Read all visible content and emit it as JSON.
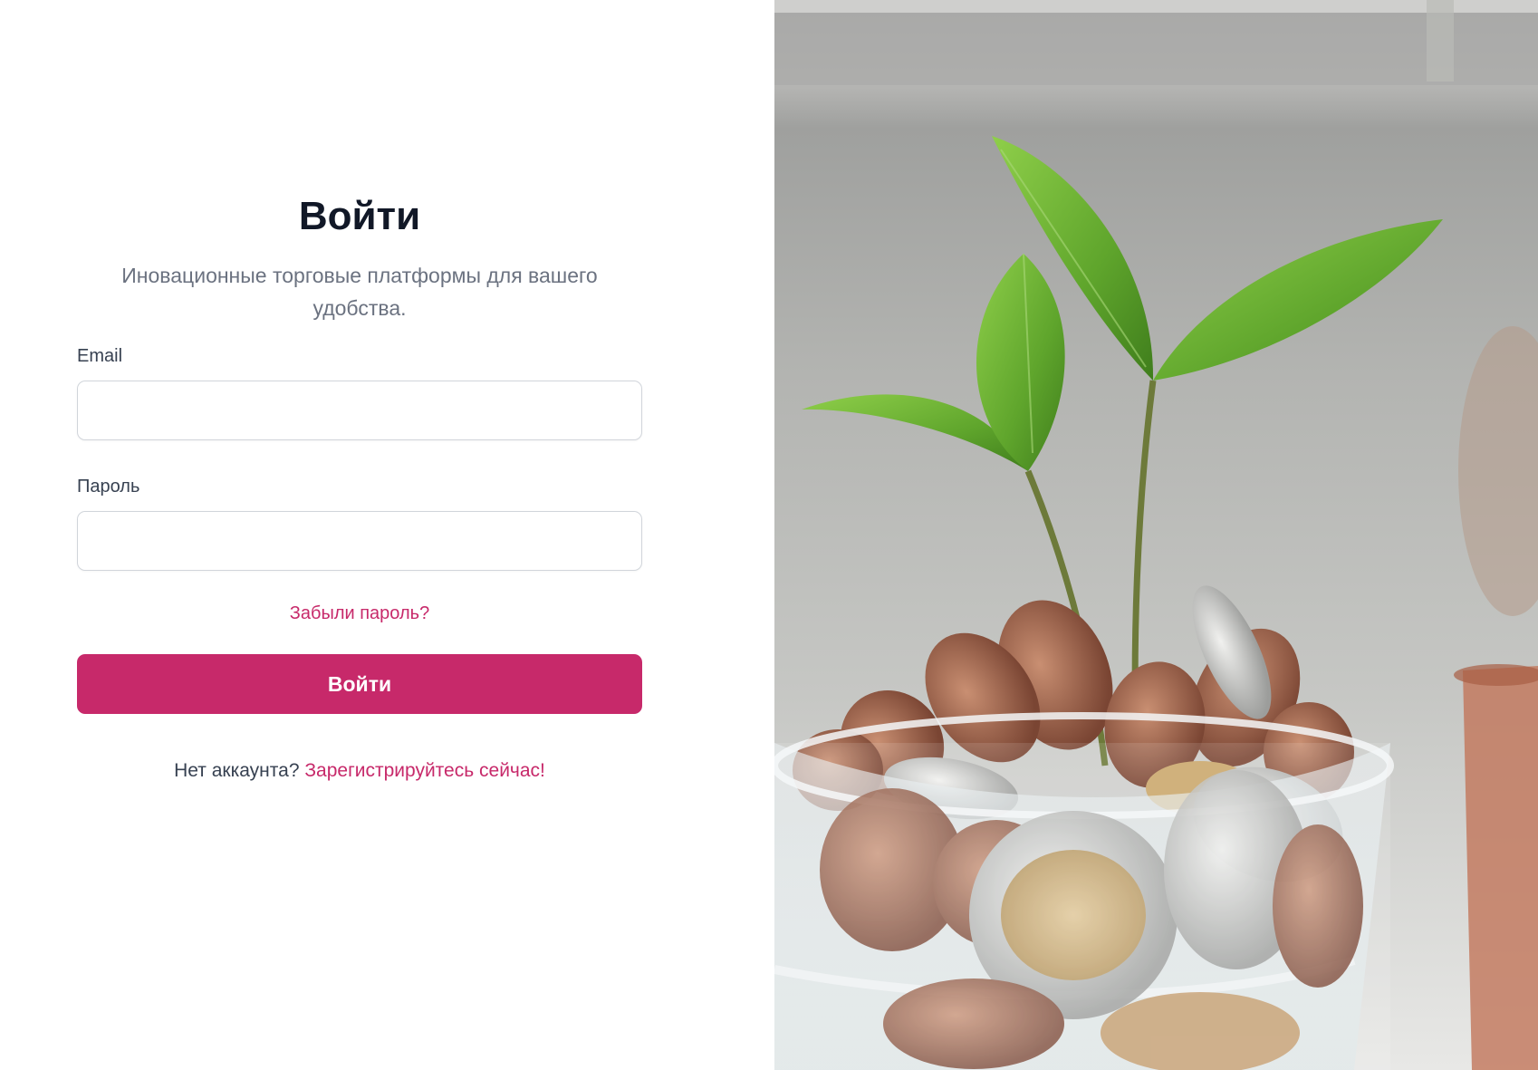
{
  "login": {
    "title": "Войти",
    "subtitle": "Иновационные торговые платформы для вашего удобства.",
    "email_label": "Email",
    "email_value": "",
    "password_label": "Пароль",
    "password_value": "",
    "forgot_link": "Забыли пароль?",
    "submit_label": "Войти",
    "register_prompt": "Нет аккаунта?",
    "register_link": "Зарегистрируйтесь сейчас!"
  },
  "hero_image": {
    "icon": "plant-in-coin-jar-photo"
  },
  "colors": {
    "accent": "#c7296a",
    "title": "#111827",
    "subtitle": "#6b7280",
    "label": "#374151",
    "input_border": "#d1d5db"
  }
}
